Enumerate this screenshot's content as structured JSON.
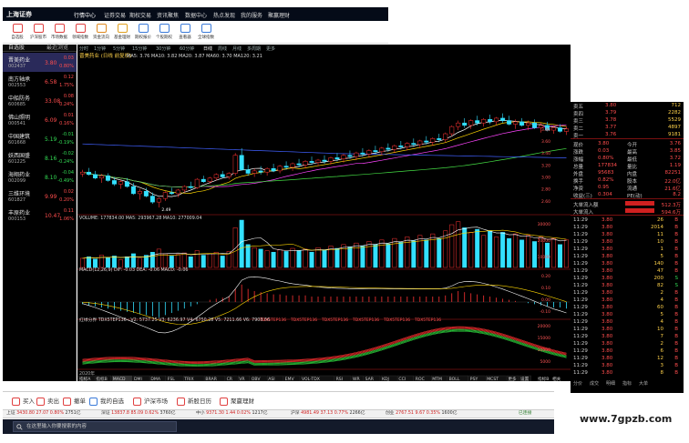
{
  "app": {
    "logo_text": "上海证券",
    "menu": [
      "行情中心",
      "证券交易",
      "期权交易",
      "资讯聚焦",
      "数据中心",
      "热点发现",
      "我的服务",
      "聚赢理财"
    ]
  },
  "toolbar": [
    {
      "label": "自选股",
      "icon": "star-icon",
      "color": "#e04040"
    },
    {
      "label": "沪深股市",
      "icon": "chart-icon",
      "color": "#e04040"
    },
    {
      "label": "市场数据",
      "icon": "grid-icon",
      "color": "#e04040"
    },
    {
      "label": "领域指数",
      "icon": "bars-icon",
      "color": "#e04040"
    },
    {
      "label": "资金流向",
      "icon": "flow-icon",
      "color": "#e08a20"
    },
    {
      "label": "基金理财",
      "icon": "coin-icon",
      "color": "#e0a020"
    },
    {
      "label": "期权报价",
      "icon": "option-icon",
      "color": "#3a7ad9"
    },
    {
      "label": "个股期权",
      "icon": "doc-icon",
      "color": "#3a7ad9"
    },
    {
      "label": "查看器",
      "icon": "eye-icon",
      "color": "#3a7ad9"
    },
    {
      "label": "全球指数",
      "icon": "globe-icon",
      "color": "#3a7ad9"
    }
  ],
  "watchlist": {
    "headers": [
      "自选股",
      "最近浏览"
    ],
    "rows": [
      {
        "name": "晋美药业",
        "code": "002437",
        "price": "3.80",
        "chg": "0.03",
        "pct": "0.80%",
        "up": true
      },
      {
        "name": "南方轴承",
        "code": "002553",
        "price": "6.58",
        "chg": "0.12",
        "pct": "1.75%",
        "up": true
      },
      {
        "name": "中船防务",
        "code": "600685",
        "price": "33.08",
        "chg": "0.08",
        "pct": "0.24%",
        "up": true
      },
      {
        "name": "佛山照明",
        "code": "000541",
        "price": "6.09",
        "chg": "0.01",
        "pct": "0.16%",
        "up": true
      },
      {
        "name": "中国建筑",
        "code": "601668",
        "price": "5.19",
        "chg": "-0.01",
        "pct": "-0.19%",
        "up": false
      },
      {
        "name": "妖西国盛",
        "code": "601225",
        "price": "8.16",
        "chg": "-0.02",
        "pct": "-0.24%",
        "up": false
      },
      {
        "name": "海翔药业",
        "code": "002099",
        "price": "8.10",
        "chg": "-0.04",
        "pct": "-0.49%",
        "up": false
      },
      {
        "name": "三维环境",
        "code": "601827",
        "price": "9.99",
        "chg": "0.02",
        "pct": "0.20%",
        "up": true
      },
      {
        "name": "丰原药业",
        "code": "000153",
        "price": "10.47",
        "chg": "0.11",
        "pct": "1.06%",
        "up": true
      }
    ]
  },
  "chart": {
    "stock_title": "晋美药业 (日线 前复权)",
    "ma_line": "MA5: 3.76  MA10: 3.82  MA20: 3.87  MA60: 3.70  MA120: 3.21",
    "period_tabs": [
      "分时",
      "1分钟",
      "5分钟",
      "15分钟",
      "30分钟",
      "60分钟",
      "日线",
      "周线",
      "月线",
      "多周期",
      "更多"
    ],
    "low_marker": "2.49",
    "volume_line": "VOLUME: 177834.00  MA5: 293967.28  MA10: 277009.04",
    "macd_line": "MACD(12,26,9)  DIF: -0.03  DEA: -0.06  MACD: -0.06",
    "indicator_line": "红绿分界  TDX5TEP136 : V2: 5737.25  V3: 6236.97  V4: 6750.28  V5: 7211.66  V6: 7908.66",
    "indicator_tags": [
      "TDX5TEP136",
      "TDX5TEP136",
      "TDX5TEP136",
      "TDX5TEP136",
      "TDX5TEP136",
      "TDX5TEP136"
    ],
    "bottom_tabs": [
      "指标A",
      "指标B",
      "MACD",
      "DMI",
      "DMA",
      "FSL",
      "TRIX",
      "BRAR",
      "CR",
      "VR",
      "OBV",
      "ASI",
      "EMV",
      "VOL-TDX",
      "RSI",
      "WR",
      "SAR",
      "KDJ",
      "CCI",
      "ROC",
      "MTM",
      "BOLL",
      "PSY",
      "MCST",
      "更多",
      "设置"
    ],
    "date_label": "2020年",
    "right_tabs": [
      "指标B",
      "相关"
    ],
    "side_tabs": [
      "分时",
      "日线"
    ],
    "price_axis": [
      "3.80",
      "3.60",
      "3.40",
      "3.20",
      "3.00",
      "2.80",
      "2.60"
    ],
    "vol_axis": [
      "30000",
      "20000",
      "10000"
    ],
    "macd_axis": [
      "0.20",
      "0.10",
      "0.00",
      "-0.10"
    ],
    "ind_axis": [
      "20000",
      "15000",
      "10000",
      "5000"
    ]
  },
  "chart_data": {
    "type": "candlestick",
    "title": "晋美药业 (日线 前复权)",
    "xlabel": "",
    "ylabel": "",
    "ylim": [
      2.4,
      4.1
    ],
    "candles": [
      [
        3.05,
        3.12,
        3.0,
        3.08
      ],
      [
        3.08,
        3.15,
        3.02,
        3.04
      ],
      [
        3.04,
        3.1,
        2.96,
        2.98
      ],
      [
        2.98,
        3.05,
        2.9,
        3.02
      ],
      [
        3.02,
        3.06,
        2.92,
        2.94
      ],
      [
        2.94,
        3.0,
        2.85,
        2.88
      ],
      [
        2.88,
        2.95,
        2.8,
        2.92
      ],
      [
        2.92,
        2.98,
        2.82,
        2.84
      ],
      [
        2.84,
        2.9,
        2.7,
        2.72
      ],
      [
        2.72,
        2.8,
        2.62,
        2.76
      ],
      [
        2.76,
        2.82,
        2.66,
        2.68
      ],
      [
        2.68,
        2.74,
        2.55,
        2.58
      ],
      [
        2.58,
        2.66,
        2.49,
        2.64
      ],
      [
        2.64,
        2.76,
        2.6,
        2.74
      ],
      [
        2.74,
        2.82,
        2.7,
        2.72
      ],
      [
        2.72,
        2.8,
        2.66,
        2.78
      ],
      [
        2.78,
        2.86,
        2.74,
        2.84
      ],
      [
        2.84,
        2.92,
        2.8,
        2.82
      ],
      [
        2.82,
        2.98,
        2.8,
        2.96
      ],
      [
        2.96,
        3.02,
        2.9,
        2.92
      ],
      [
        2.92,
        3.0,
        2.88,
        2.98
      ],
      [
        2.98,
        3.06,
        2.94,
        3.04
      ],
      [
        3.04,
        3.1,
        2.98,
        3.0
      ],
      [
        3.0,
        3.08,
        2.96,
        3.06
      ],
      [
        3.06,
        3.4,
        3.02,
        3.36
      ],
      [
        3.36,
        3.48,
        3.1,
        3.12
      ],
      [
        3.12,
        3.2,
        3.02,
        3.06
      ],
      [
        3.06,
        3.14,
        3.0,
        3.1
      ],
      [
        3.1,
        3.18,
        3.04,
        3.08
      ],
      [
        3.08,
        3.16,
        3.02,
        3.14
      ],
      [
        3.14,
        3.22,
        3.08,
        3.1
      ],
      [
        3.1,
        3.2,
        3.06,
        3.18
      ],
      [
        3.18,
        3.26,
        3.12,
        3.16
      ],
      [
        3.16,
        3.24,
        3.1,
        3.22
      ],
      [
        3.22,
        3.3,
        3.16,
        3.2
      ],
      [
        3.2,
        3.28,
        3.14,
        3.26
      ],
      [
        3.26,
        3.34,
        3.2,
        3.24
      ],
      [
        3.24,
        3.3,
        3.18,
        3.28
      ],
      [
        3.28,
        3.36,
        3.22,
        3.26
      ],
      [
        3.26,
        3.34,
        3.2,
        3.32
      ],
      [
        3.32,
        3.4,
        3.26,
        3.3
      ],
      [
        3.3,
        3.38,
        3.24,
        3.36
      ],
      [
        3.36,
        3.44,
        3.3,
        3.34
      ],
      [
        3.34,
        3.42,
        3.28,
        3.4
      ],
      [
        3.4,
        3.48,
        3.34,
        3.38
      ],
      [
        3.38,
        3.46,
        3.32,
        3.44
      ],
      [
        3.44,
        3.52,
        3.38,
        3.42
      ],
      [
        3.42,
        3.5,
        3.36,
        3.48
      ],
      [
        3.48,
        3.56,
        3.42,
        3.46
      ],
      [
        3.46,
        3.54,
        3.4,
        3.52
      ],
      [
        3.52,
        3.6,
        3.46,
        3.5
      ],
      [
        3.5,
        3.58,
        3.44,
        3.56
      ],
      [
        3.56,
        3.64,
        3.5,
        3.54
      ],
      [
        3.54,
        3.62,
        3.48,
        3.6
      ],
      [
        3.6,
        3.68,
        3.54,
        3.58
      ],
      [
        3.58,
        3.66,
        3.52,
        3.64
      ],
      [
        3.64,
        3.72,
        3.58,
        3.62
      ],
      [
        3.62,
        3.74,
        3.58,
        3.72
      ],
      [
        3.72,
        3.86,
        3.68,
        3.84
      ],
      [
        3.84,
        3.94,
        3.78,
        3.9
      ],
      [
        3.9,
        3.98,
        3.82,
        3.86
      ],
      [
        3.86,
        3.96,
        3.8,
        3.94
      ],
      [
        3.94,
        4.02,
        3.86,
        3.9
      ],
      [
        3.9,
        3.98,
        3.84,
        3.96
      ],
      [
        3.96,
        4.04,
        3.88,
        3.92
      ],
      [
        3.92,
        4.0,
        3.86,
        3.98
      ],
      [
        3.98,
        4.06,
        3.9,
        3.94
      ],
      [
        3.94,
        4.02,
        3.86,
        3.88
      ],
      [
        3.88,
        3.96,
        3.8,
        3.92
      ],
      [
        3.92,
        3.98,
        3.84,
        3.86
      ],
      [
        3.86,
        3.94,
        3.78,
        3.9
      ],
      [
        3.9,
        3.96,
        3.8,
        3.82
      ],
      [
        3.82,
        3.9,
        3.74,
        3.86
      ],
      [
        3.86,
        3.92,
        3.76,
        3.78
      ],
      [
        3.78,
        3.86,
        3.72,
        3.82
      ],
      [
        3.82,
        3.88,
        3.74,
        3.76
      ],
      [
        3.76,
        3.84,
        3.7,
        3.8
      ]
    ],
    "volume": [
      120,
      140,
      110,
      160,
      130,
      150,
      100,
      140,
      180,
      120,
      160,
      200,
      240,
      180,
      150,
      170,
      190,
      140,
      220,
      160,
      180,
      200,
      150,
      210,
      520,
      620,
      300,
      260,
      240,
      220,
      200,
      230,
      210,
      250,
      220,
      240,
      200,
      260,
      230,
      280,
      250,
      300,
      270,
      320,
      280,
      340,
      300,
      360,
      310,
      380,
      330,
      400,
      350,
      420,
      360,
      440,
      380,
      480,
      560,
      600,
      520,
      460,
      500,
      420,
      480,
      400,
      460,
      380,
      440,
      360,
      420,
      340,
      400,
      320,
      380,
      300,
      360
    ],
    "macd_hist": [
      -0.02,
      -0.03,
      -0.04,
      -0.05,
      -0.06,
      -0.07,
      -0.08,
      -0.09,
      -0.1,
      -0.11,
      -0.12,
      -0.13,
      -0.14,
      -0.12,
      -0.1,
      -0.08,
      -0.06,
      -0.04,
      -0.02,
      0.0,
      0.02,
      0.03,
      0.04,
      0.05,
      0.12,
      0.16,
      0.12,
      0.1,
      0.09,
      0.08,
      0.07,
      0.07,
      0.06,
      0.06,
      0.06,
      0.06,
      0.05,
      0.05,
      0.05,
      0.05,
      0.05,
      0.05,
      0.05,
      0.05,
      0.05,
      0.05,
      0.05,
      0.05,
      0.05,
      0.05,
      0.05,
      0.05,
      0.05,
      0.05,
      0.05,
      0.05,
      0.05,
      0.06,
      0.08,
      0.1,
      0.09,
      0.08,
      0.07,
      0.06,
      0.05,
      0.04,
      0.03,
      0.02,
      0.01,
      0.0,
      -0.01,
      -0.02,
      -0.03,
      -0.04,
      -0.05,
      -0.05,
      -0.06
    ]
  },
  "quote": {
    "sell": [
      {
        "label": "卖五",
        "price": "3.80",
        "vol": "712"
      },
      {
        "label": "卖四",
        "price": "3.79",
        "vol": "2282"
      },
      {
        "label": "卖三",
        "price": "3.78",
        "vol": "5529"
      },
      {
        "label": "卖二",
        "price": "3.77",
        "vol": "4897"
      },
      {
        "label": "卖一",
        "price": "3.76",
        "vol": "9181"
      }
    ],
    "stats": [
      {
        "k": "现价",
        "v": "3.80",
        "k2": "今开",
        "v2": "3.76"
      },
      {
        "k": "涨跌",
        "v": "0.03",
        "k2": "最高",
        "v2": "3.85"
      },
      {
        "k": "涨幅",
        "v": "0.80%",
        "k2": "最低",
        "v2": "3.72"
      },
      {
        "k": "总量",
        "v": "177834",
        "k2": "量比",
        "v2": "1.19"
      },
      {
        "k": "外盘",
        "v": "95683",
        "k2": "内盘",
        "v2": "82251"
      },
      {
        "k": "换手",
        "v": "0.82%",
        "k2": "股本",
        "v2": "22.0亿"
      },
      {
        "k": "净资",
        "v": "0.95",
        "k2": "流通",
        "v2": "21.6亿"
      },
      {
        "k": "收益(三)",
        "v": "0.304",
        "k2": "PE(动)",
        "v2": "8.2"
      }
    ],
    "flow": [
      {
        "label": "大单流入额",
        "value": "512.3万"
      },
      {
        "label": "大单流入",
        "value": "594.6万"
      }
    ],
    "ticks": [
      {
        "t": "11:29",
        "p": "3.80",
        "v": "26",
        "s": "B"
      },
      {
        "t": "11:29",
        "p": "3.80",
        "v": "2014",
        "s": "B"
      },
      {
        "t": "11:29",
        "p": "3.80",
        "v": "11",
        "s": "B"
      },
      {
        "t": "11:29",
        "p": "3.80",
        "v": "10",
        "s": "B"
      },
      {
        "t": "11:29",
        "p": "3.80",
        "v": "1",
        "s": "B"
      },
      {
        "t": "11:29",
        "p": "3.80",
        "v": "5",
        "s": "B"
      },
      {
        "t": "11:29",
        "p": "3.80",
        "v": "140",
        "s": "B"
      },
      {
        "t": "11:29",
        "p": "3.80",
        "v": "47",
        "s": "B"
      },
      {
        "t": "11:29",
        "p": "3.80",
        "v": "200",
        "s": "S"
      },
      {
        "t": "11:29",
        "p": "3.80",
        "v": "82",
        "s": "S"
      },
      {
        "t": "11:29",
        "p": "3.80",
        "v": "2",
        "s": "B"
      },
      {
        "t": "11:29",
        "p": "3.80",
        "v": "4",
        "s": "B"
      },
      {
        "t": "11:29",
        "p": "3.80",
        "v": "60",
        "s": "B"
      },
      {
        "t": "11:29",
        "p": "3.80",
        "v": "5",
        "s": "B"
      },
      {
        "t": "11:29",
        "p": "3.80",
        "v": "4",
        "s": "B"
      },
      {
        "t": "11:29",
        "p": "3.80",
        "v": "10",
        "s": "B"
      },
      {
        "t": "11:29",
        "p": "3.80",
        "v": "7",
        "s": "B"
      },
      {
        "t": "11:29",
        "p": "3.80",
        "v": "2",
        "s": "B"
      },
      {
        "t": "11:29",
        "p": "3.80",
        "v": "6",
        "s": "B"
      },
      {
        "t": "11:29",
        "p": "3.80",
        "v": "12",
        "s": "B"
      },
      {
        "t": "11:29",
        "p": "3.80",
        "v": "3",
        "s": "B"
      },
      {
        "t": "11:29",
        "p": "3.80",
        "v": "8",
        "s": "B"
      },
      {
        "t": "11:29",
        "p": "3.80",
        "v": "1",
        "s": "B"
      },
      {
        "t": "11:29",
        "p": "3.80",
        "v": "15",
        "s": "B"
      }
    ],
    "bottom_tabs": [
      "分价",
      "成交",
      "明细",
      "指标",
      "大单"
    ]
  },
  "actions": [
    {
      "label": "买入",
      "icon": "buy-icon",
      "color": "#e04040"
    },
    {
      "label": "卖出",
      "icon": "sell-icon",
      "color": "#e04040"
    },
    {
      "label": "撤单",
      "icon": "cancel-icon",
      "color": "#e04040"
    },
    {
      "label": "我的自选",
      "icon": "mine-icon",
      "color": "#3a7ad9"
    },
    {
      "label": "沪深市场",
      "icon": "market-icon",
      "color": "#e04040"
    },
    {
      "label": "新股日历",
      "icon": "calendar-icon",
      "color": "#e04040"
    },
    {
      "label": "聚赢理财",
      "icon": "finance-icon",
      "color": "#e04040"
    }
  ],
  "ticker": {
    "items": [
      {
        "name": "上证",
        "val": "3430.80",
        "chg": "27.07",
        "pct": "0.80%",
        "amt": "2751亿"
      },
      {
        "name": "深证",
        "val": "13837.8",
        "chg": "85.09",
        "pct": "0.62%",
        "amt": "3760亿"
      },
      {
        "name": "中小",
        "val": "9371.30",
        "chg": "1.44",
        "pct": "0.02%",
        "amt": "1217亿"
      },
      {
        "name": "沪深",
        "val": "4981.49",
        "chg": "37.13",
        "pct": "0.77%",
        "amt": "2266亿"
      },
      {
        "name": "创业",
        "val": "2767.51",
        "chg": "9.67",
        "pct": "0.35%",
        "amt": "1600亿"
      }
    ],
    "status": "已连接"
  },
  "taskbar": {
    "search_placeholder": "在这里输入你要搜索的内容"
  },
  "watermark": "www.7gpzb.com"
}
